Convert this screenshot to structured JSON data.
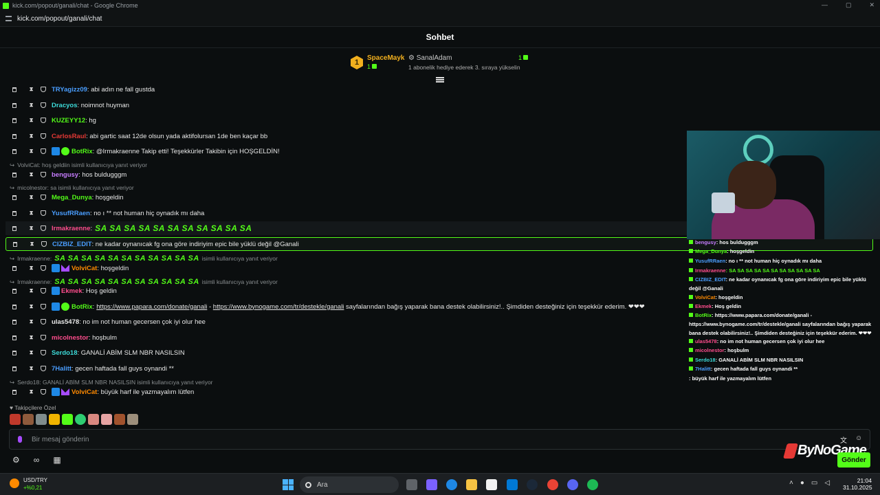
{
  "window": {
    "title": "kick.com/popout/ganali/chat - Google Chrome",
    "url": "kick.com/popout/ganali/chat"
  },
  "chat": {
    "title": "Sohbet",
    "pinned": {
      "rank": "1",
      "leader_name": "SpaceMayk",
      "leader_count": "1",
      "second_name": "SanalAdam",
      "second_count": "1",
      "hint": "1 abonelik hediye ederek 3. sıraya yükselin"
    },
    "messages": [
      {
        "user": "TRYagizz09",
        "text": ": abi adın ne fall gustda"
      },
      {
        "user": "Dracyos",
        "text": ": noimnot huyman"
      },
      {
        "user": "KUZEYY12",
        "text": ": hg"
      },
      {
        "user": "CarlosRaul",
        "text": ": abi gartic saat 12de olsun yada aktifolursan 1de ben kaçar bb"
      },
      {
        "user": "BotRix",
        "text": ": @Irmakraenne Takip etti! Teşekkürler Takibin için HOŞGELDİN!"
      },
      {
        "reply": "VolviCat: hoş geldiin isimli kullanıcıya yanıt veriyor"
      },
      {
        "user": "bengusy",
        "text": ": hos buldugggm"
      },
      {
        "reply": "micolnestor: sa isimli kullanıcıya yanıt veriyor"
      },
      {
        "user": "Mega_Dunya",
        "text": ": hoşgeldin"
      },
      {
        "user": "YusufRRaen",
        "text": ": no ı ** not human hiç oynadık mı daha"
      },
      {
        "user": "Irmakraenne",
        "text": ":",
        "emote": "SA SA SA SA SA SA SA SA SA SA SA"
      },
      {
        "user": "CIZBIZ_EDIT",
        "text": ": ne kadar oynanıcak fg ona göre indiriyim epic bile yüklü değil @Ganali"
      },
      {
        "reply_name": "Irmakraenne:",
        "reply_emote": "SA SA SA SA SA SA SA SA SA SA SA",
        "reply_tail": "isimli kullanıcıya yanıt veriyor"
      },
      {
        "user": "VolviCat",
        "text": ": hoşgeldin"
      },
      {
        "reply_name": "Irmakraenne:",
        "reply_emote": "SA SA SA SA SA SA SA SA SA SA SA",
        "reply_tail": "isimli kullanıcıya yanıt veriyor"
      },
      {
        "user": "Ekmek",
        "text": ": Hoş geldin"
      },
      {
        "user": "BotRix",
        "text": ":",
        "link1": "https://www.papara.com/donate/ganali",
        "sep": " - ",
        "link2": "https://www.bynogame.com/tr/destekle/ganali",
        "tail": " sayfalarından bağış yaparak bana destek olabilirsiniz!.. Şimdiden desteğiniz için teşekkür ederim. ❤❤❤"
      },
      {
        "user": "ulas5478",
        "text": ": no im not human gecersen çok iyi olur hee"
      },
      {
        "user": "micolnestor",
        "text": ": hoşbulm"
      },
      {
        "user": "Serdo18",
        "text": ": GANALİ ABİM SLM NBR NASILSIN"
      },
      {
        "user": "7Halitt",
        "text": ": gecen haftada fall guys oynandi **"
      },
      {
        "reply": "Serdo18: GANALİ ABİM SLM NBR NASILSIN isimli kullanıcıya yanıt veriyor"
      },
      {
        "user": "VolviCat",
        "text": ": büyük harf ile yazmayalım lütfen"
      }
    ],
    "followers_label": "Takipçilere Özel",
    "input_placeholder": "Bir mesaj gönderin",
    "send_label": "Gönder"
  },
  "overlay": {
    "brand": "ByNoGame",
    "lines": [
      {
        "user": "bengusy",
        "text": ": hos buldugggm"
      },
      {
        "user": "Mega_Dunya",
        "text": ": hoşgeldin"
      },
      {
        "user": "YusufRRaen",
        "text": ": no ı ** not human hiç oynadık mı daha"
      },
      {
        "user": "Irmakraenne",
        "text": ": SA SA SA SA SA SA SA SA SA SA SA"
      },
      {
        "user": "CIZBIZ_EDIT",
        "text": ": ne kadar oynanıcak fg ona göre indiriyim epic bile yüklü değil @Ganali"
      },
      {
        "user": "VolviCat",
        "text": ": hoşgeldin"
      },
      {
        "user": "Ekmek",
        "text": ": Hoş geldin"
      },
      {
        "user": "BotRix",
        "text": ": https://www.papara.com/donate/ganali - https://www.bynogame.com/tr/destekle/ganali sayfalarından bağış yaparak bana destek olabilirsiniz!.. Şimdiden desteğiniz için teşekkür ederim. ❤❤❤"
      },
      {
        "user": "ulas5478",
        "text": ": no im not human gecersen çok iyi olur hee"
      },
      {
        "user": "micolnestor",
        "text": ": hoşbulm"
      },
      {
        "user": "Serdo18",
        "text": ": GANALİ ABİM SLM NBR NASILSIN"
      },
      {
        "user": "7Halitt",
        "text": ": gecen haftada fall guys oynandi **"
      },
      {
        "user": "",
        "text": ": büyük harf ile yazmayalım lütfen"
      }
    ]
  },
  "taskbar": {
    "ticker_name": "USD/TRY",
    "ticker_change": "+%0,21",
    "search_placeholder": "Ara",
    "time": "21:04",
    "date": "31.10.2025"
  },
  "colors": {
    "accent": "#53fc18",
    "background": "#0b0e0f"
  }
}
